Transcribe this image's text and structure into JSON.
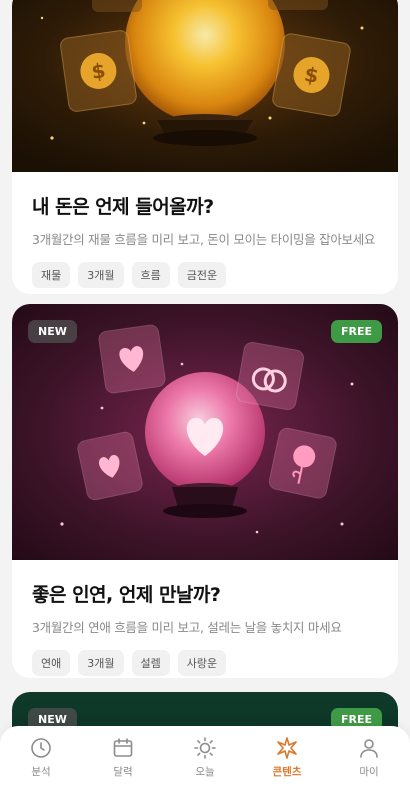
{
  "cards": [
    {
      "title": "내 돈은 언제 들어올까?",
      "desc": "3개월간의 재물 흐름을 미리 보고, 돈이 모이는 타이밍을 잡아보세요",
      "tags": [
        "재물",
        "3개월",
        "흐름",
        "금전운"
      ],
      "image_icon": "crystal-ball-coins"
    },
    {
      "badge_new": "NEW",
      "badge_free": "FREE",
      "title": "좋은 인연, 언제 만날까?",
      "desc": "3개월간의 연애 흐름을 미리 보고, 설레는 날을 놓치지 마세요",
      "tags": [
        "연애",
        "3개월",
        "설렘",
        "사랑운"
      ],
      "image_icon": "crystal-ball-hearts"
    },
    {
      "badge_new": "NEW",
      "badge_free": "FREE"
    }
  ],
  "tabbar": {
    "items": [
      {
        "label": "분석",
        "icon": "clock-icon"
      },
      {
        "label": "달력",
        "icon": "calendar-icon"
      },
      {
        "label": "오늘",
        "icon": "sun-icon"
      },
      {
        "label": "콘텐츠",
        "icon": "sparkle-icon",
        "active": true
      },
      {
        "label": "마이",
        "icon": "person-icon"
      }
    ]
  },
  "colors": {
    "accent": "#d8792c",
    "free_badge": "#3f9a46",
    "money_bg": "#2a1a08",
    "love_bg": "#3b1328"
  }
}
